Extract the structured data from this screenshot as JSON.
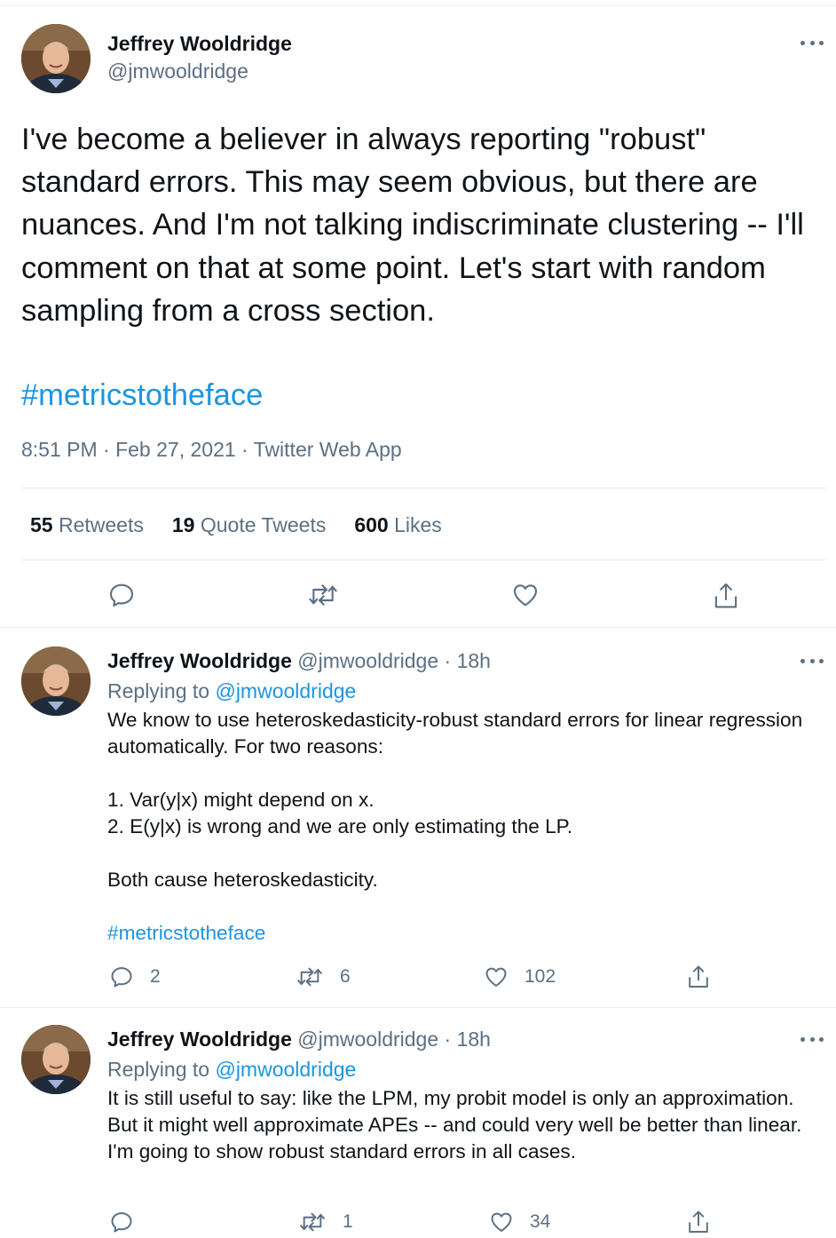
{
  "main": {
    "author_name": "Jeffrey Wooldridge",
    "author_handle": "@jmwooldridge",
    "text": "I've become a believer in always reporting \"robust\" standard errors. This may seem obvious, but there are nuances. And I'm not talking indiscriminate clustering -- I'll comment on that at some point. Let's start with random sampling from a cross section.",
    "hashtag": "#metricstotheface",
    "meta": "8:51 PM · Feb 27, 2021 · Twitter Web App",
    "stats": {
      "retweets_count": "55",
      "retweets_label": "Retweets",
      "quotes_count": "19",
      "quotes_label": "Quote Tweets",
      "likes_count": "600",
      "likes_label": "Likes"
    },
    "icons": [
      "reply-icon",
      "retweet-icon",
      "like-icon",
      "share-icon"
    ]
  },
  "replies": [
    {
      "author_name": "Jeffrey Wooldridge",
      "author_handle": "@jmwooldridge",
      "time": "· 18h",
      "replying_label": "Replying to",
      "replying_handle": "@jmwooldridge",
      "lines": [
        "We know to use heteroskedasticity-robust standard errors for linear regression automatically. For two reasons:",
        "",
        "1. Var(y|x) might depend on x.",
        "2. E(y|x) is wrong and we are only estimating the LP.",
        "",
        "Both cause heteroskedasticity.",
        ""
      ],
      "hashtag": "#metricstotheface",
      "reply_count": "2",
      "retweet_count": "6",
      "like_count": "102"
    },
    {
      "author_name": "Jeffrey Wooldridge",
      "author_handle": "@jmwooldridge",
      "time": "· 18h",
      "replying_label": "Replying to",
      "replying_handle": "@jmwooldridge",
      "lines": [
        "It is still useful to say: like the LPM, my probit model is only an approximation. But it might well approximate APEs -- and could very well be better than linear. I'm going to show robust standard errors in all cases."
      ],
      "reply_count": "",
      "retweet_count": "1",
      "like_count": "34"
    }
  ],
  "colors": {
    "link": "#1b95e0",
    "muted": "#5b7083",
    "text": "#0f1419",
    "divider": "#e6ecf0"
  }
}
